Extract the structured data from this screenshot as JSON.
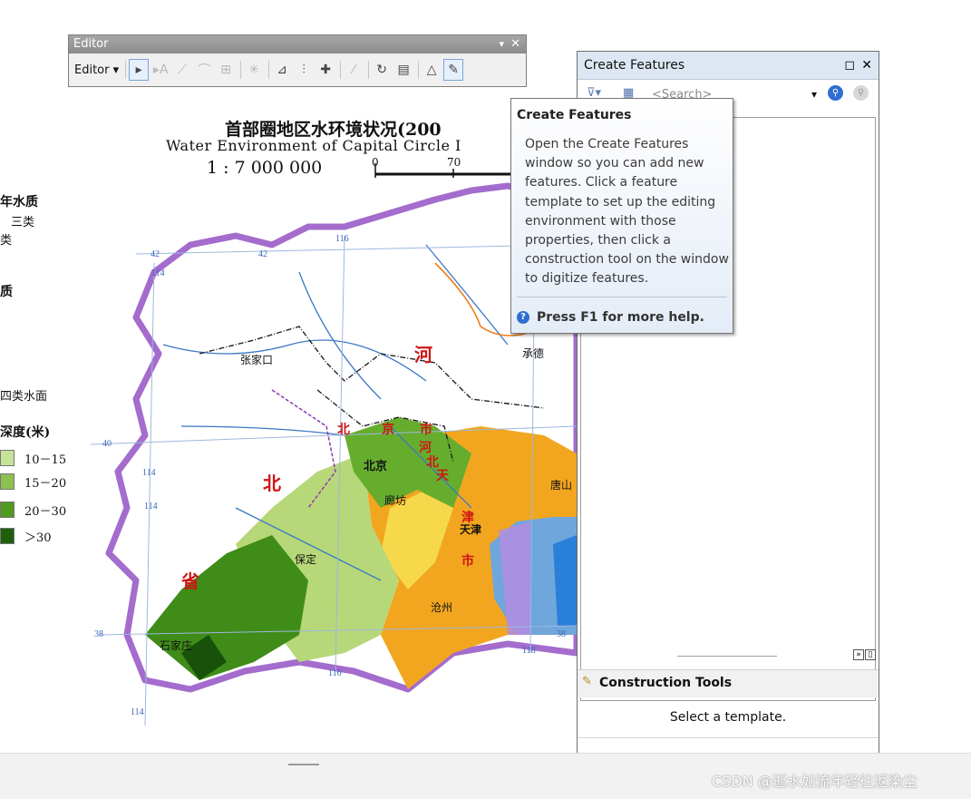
{
  "map": {
    "title_cn": "首部圈地区水环境状况(200",
    "title_en": "Water Environment of Capital Circle I",
    "scale_text": "1 : 7 000 000",
    "scale_ticks": [
      "0",
      "70"
    ],
    "legend": {
      "fragment_1": "年水质",
      "fragment_2": "三类",
      "fragment_3": "类",
      "fragment_4": "质",
      "fragment_5": "四类水面",
      "depth_heading": "深度(米)",
      "depth_ranges": [
        "10－15",
        "15－20",
        "20－30",
        "＞30"
      ],
      "depth_colors": [
        "#c6e39a",
        "#8cc152",
        "#4f9a1f",
        "#1f5e0b"
      ]
    },
    "place_labels": [
      "张家口",
      "承德",
      "北京",
      "廊坊",
      "天津",
      "唐山",
      "保定",
      "沧州",
      "石家庄"
    ],
    "province_labels": [
      "河",
      "北",
      "省",
      "北",
      "京",
      "市",
      "河",
      "北",
      "天",
      "津",
      "市"
    ],
    "grid_labels": [
      "42",
      "42",
      "116",
      "114",
      "40",
      "114",
      "114",
      "38",
      "116",
      "118",
      "38",
      "114"
    ]
  },
  "editor": {
    "title": "Editor",
    "menu_label": "Editor ▾",
    "tools": [
      {
        "name": "edit-tool-icon",
        "glyph": "▸",
        "state": "active"
      },
      {
        "name": "edit-annotation-icon",
        "glyph": "▸A",
        "state": "disabled"
      },
      {
        "name": "straight-segment-icon",
        "glyph": "⟋",
        "state": "disabled"
      },
      {
        "name": "end-point-arc-icon",
        "glyph": "⌒",
        "state": "disabled"
      },
      {
        "name": "trace-icon",
        "glyph": "⊞",
        "state": "disabled"
      },
      {
        "name": "point-icon",
        "glyph": "✳",
        "state": "disabled"
      },
      {
        "name": "edit-vertices-icon",
        "glyph": "⊿",
        "state": "normal"
      },
      {
        "name": "reshape-icon",
        "glyph": "⫶",
        "state": "normal"
      },
      {
        "name": "cut-polygons-icon",
        "glyph": "✚",
        "state": "normal"
      },
      {
        "name": "split-icon",
        "glyph": "⁄",
        "state": "disabled"
      },
      {
        "name": "rotate-icon",
        "glyph": "↻",
        "state": "normal"
      },
      {
        "name": "attributes-icon",
        "glyph": "▤",
        "state": "normal"
      },
      {
        "name": "sketch-properties-icon",
        "glyph": "△",
        "state": "normal"
      },
      {
        "name": "create-features-icon",
        "glyph": "✎",
        "state": "active"
      }
    ]
  },
  "create_features": {
    "title": "Create Features",
    "search_placeholder": "<Search>",
    "construction_tools_title": "Construction Tools",
    "select_template_text": "Select a template."
  },
  "tooltip": {
    "title": "Create Features",
    "body": "Open the Create Features window so you can add new features. Click a feature template to set up the editing environment with those properties, then click a construction tool on the window to digitize features.",
    "help": "Press F1 for more help."
  },
  "watermark": "CSDN @逝水如流年轻往返染尘"
}
